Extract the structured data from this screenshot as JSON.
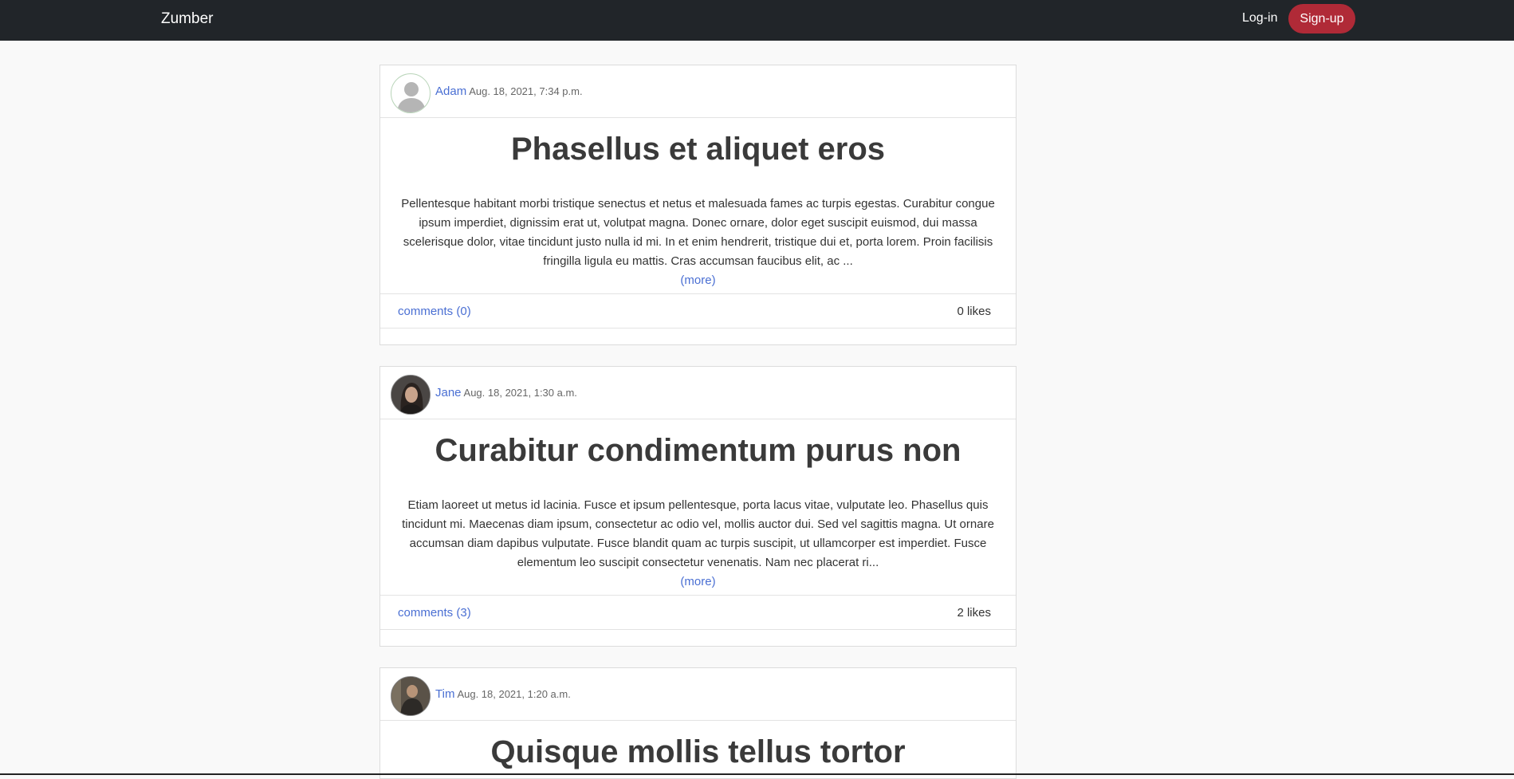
{
  "app": {
    "brand": "Zumber"
  },
  "nav": {
    "login_label": "Log-in",
    "signup_label": "Sign-up"
  },
  "posts": [
    {
      "author": "Adam",
      "date": "Aug. 18, 2021, 7:34 p.m.",
      "avatar": "default-avatar-icon",
      "title": "Phasellus et aliquet eros",
      "excerpt": "Pellentesque habitant morbi tristique senectus et netus et malesuada fames ac turpis egestas. Curabitur congue ipsum imperdiet, dignissim erat ut, volutpat magna. Donec ornare, dolor eget suscipit euismod, dui massa scelerisque dolor, vitae tincidunt justo nulla id mi. In et enim hendrerit, tristique dui et, porta lorem. Proin facilisis fringilla ligula eu mattis. Cras accumsan faucibus elit, ac ...",
      "more": "(more)",
      "comments": "comments (0)",
      "likes": "0 likes"
    },
    {
      "author": "Jane",
      "date": "Aug. 18, 2021, 1:30 a.m.",
      "avatar": "user-photo",
      "title": "Curabitur condimentum purus non",
      "excerpt": "Etiam laoreet ut metus id lacinia. Fusce et ipsum pellentesque, porta lacus vitae, vulputate leo. Phasellus quis tincidunt mi. Maecenas diam ipsum, consectetur ac odio vel, mollis auctor dui. Sed vel sagittis magna. Ut ornare accumsan diam dapibus vulputate. Fusce blandit quam ac turpis suscipit, ut ullamcorper est imperdiet. Fusce elementum leo suscipit consectetur venenatis. Nam nec placerat ri...",
      "more": "(more)",
      "comments": "comments (3)",
      "likes": "2 likes"
    },
    {
      "author": "Tim",
      "date": "Aug. 18, 2021, 1:20 a.m.",
      "avatar": "user-photo",
      "title": "Quisque mollis tellus tortor"
    }
  ]
}
